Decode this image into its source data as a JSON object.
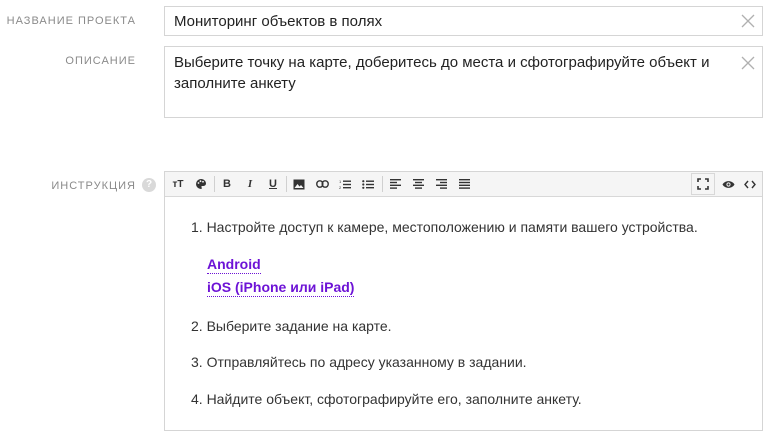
{
  "fields": {
    "name": {
      "label": "НАЗВАНИЕ ПРОЕКТА",
      "value": "Мониторинг объектов в полях"
    },
    "description": {
      "label": "ОПИСАНИЕ",
      "line1": "Выберите точку на карте, доберитесь до места и сфотографируйте объект и",
      "line2": "заполните анкету"
    },
    "instruction": {
      "label": "ИНСТРУКЦИЯ",
      "help": "?"
    }
  },
  "toolbar": {
    "text_size": "тT",
    "bold": "B",
    "italic": "I",
    "underline": "U"
  },
  "instruction": {
    "steps": [
      "1. Настройте доступ к камере, местоположению и памяти вашего устройства.",
      "2. Выберите задание на карте.",
      "3. Отправляйтесь по адресу указанному в задании.",
      "4. Найдите объект, сфотографируйте его, заполните анкету."
    ],
    "links": [
      "Android",
      "iOS (iPhone или iPad)"
    ]
  },
  "colors": {
    "link": "#6d13d6",
    "border": "#d5d5d5",
    "label": "#8a8a8a"
  }
}
